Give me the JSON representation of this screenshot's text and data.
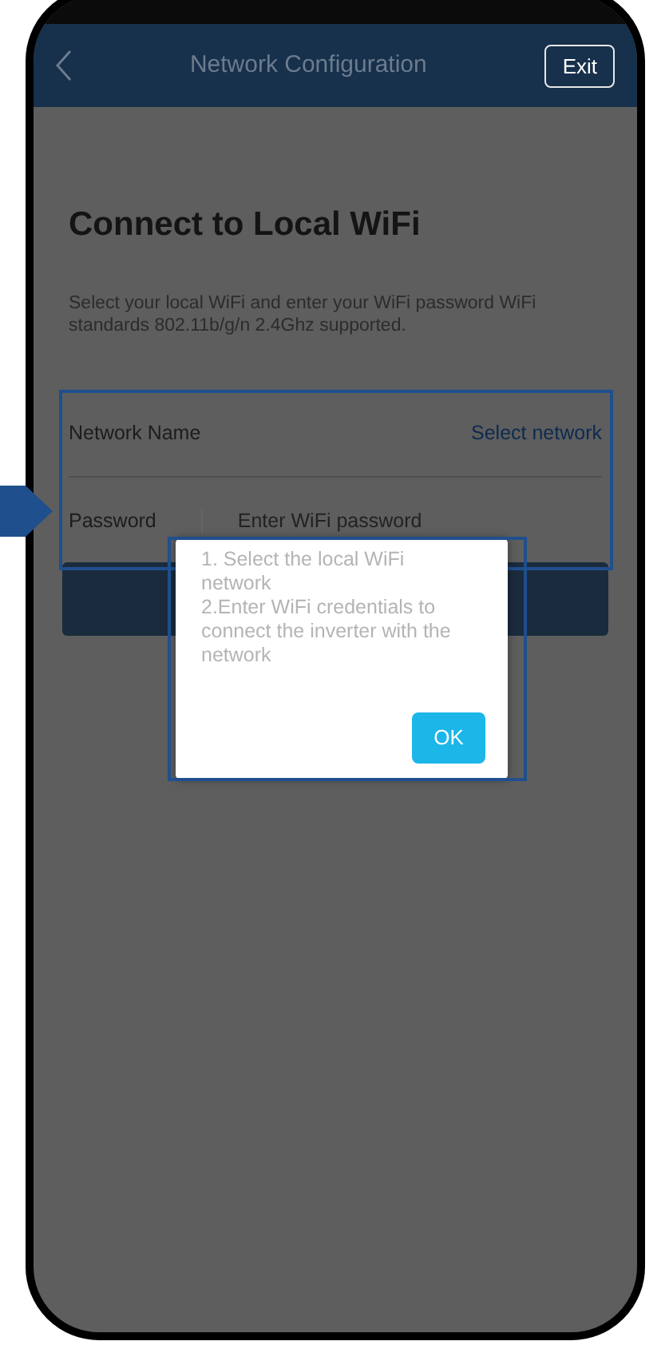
{
  "header": {
    "title": "Network Configuration",
    "exit_button": "Exit"
  },
  "page": {
    "title": "Connect to Local WiFi",
    "description": "Select your local WiFi and enter your WiFi password WiFi standards 802.11b/g/n 2.4Ghz supported."
  },
  "form": {
    "network_name_label": "Network Name",
    "select_network_link": "Select network",
    "password_label": "Password",
    "password_placeholder": "Enter WiFi password"
  },
  "dialog": {
    "lines": [
      "1. Select the local WiFi network",
      "2.Enter WiFi credentials to connect the inverter with the network"
    ],
    "ok_button": "OK"
  }
}
